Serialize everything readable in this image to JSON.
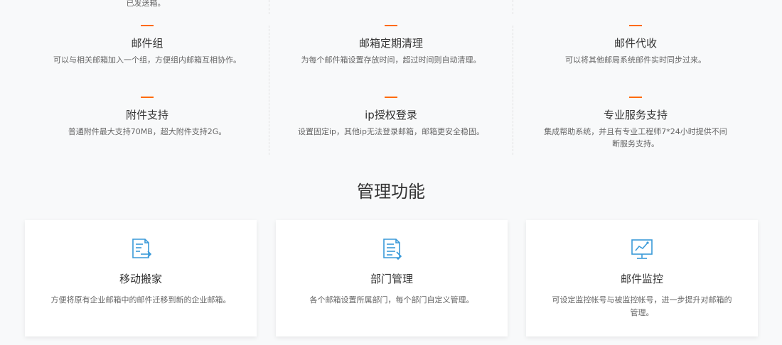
{
  "top_cut_text": "已发送箱。",
  "features": [
    {
      "title": "邮件组",
      "desc": "可以与相关邮箱加入一个组，方便组内邮箱互相协作。"
    },
    {
      "title": "邮箱定期清理",
      "desc": "为每个邮件箱设置存放时间，超过时间则自动清理。"
    },
    {
      "title": "邮件代收",
      "desc": "可以将其他邮局系统邮件实时同步过来。"
    },
    {
      "title": "附件支持",
      "desc": "普通附件最大支持70MB，超大附件支持2G。"
    },
    {
      "title": "ip授权登录",
      "desc": "设置固定ip，其他ip无法登录邮箱，邮箱更安全稳固。"
    },
    {
      "title": "专业服务支持",
      "desc": "集成帮助系统，并且有专业工程师7*24小时提供不间断服务支持。"
    }
  ],
  "management": {
    "title": "管理功能",
    "cards": [
      {
        "title": "移动搬家",
        "desc": "方便将原有企业邮箱中的邮件迁移到新的企业邮箱。",
        "icon": "document-transfer-icon"
      },
      {
        "title": "部门管理",
        "desc": "各个邮箱设置所属部门，每个部门自定义管理。",
        "icon": "document-list-icon"
      },
      {
        "title": "邮件监控",
        "desc": "可设定监控帐号与被监控帐号，进一步提升对邮箱的管理。",
        "icon": "monitor-chart-icon"
      }
    ]
  },
  "colors": {
    "accent": "#ff6a00",
    "icon": "#3a9ad9",
    "background": "#f8f9fa"
  }
}
